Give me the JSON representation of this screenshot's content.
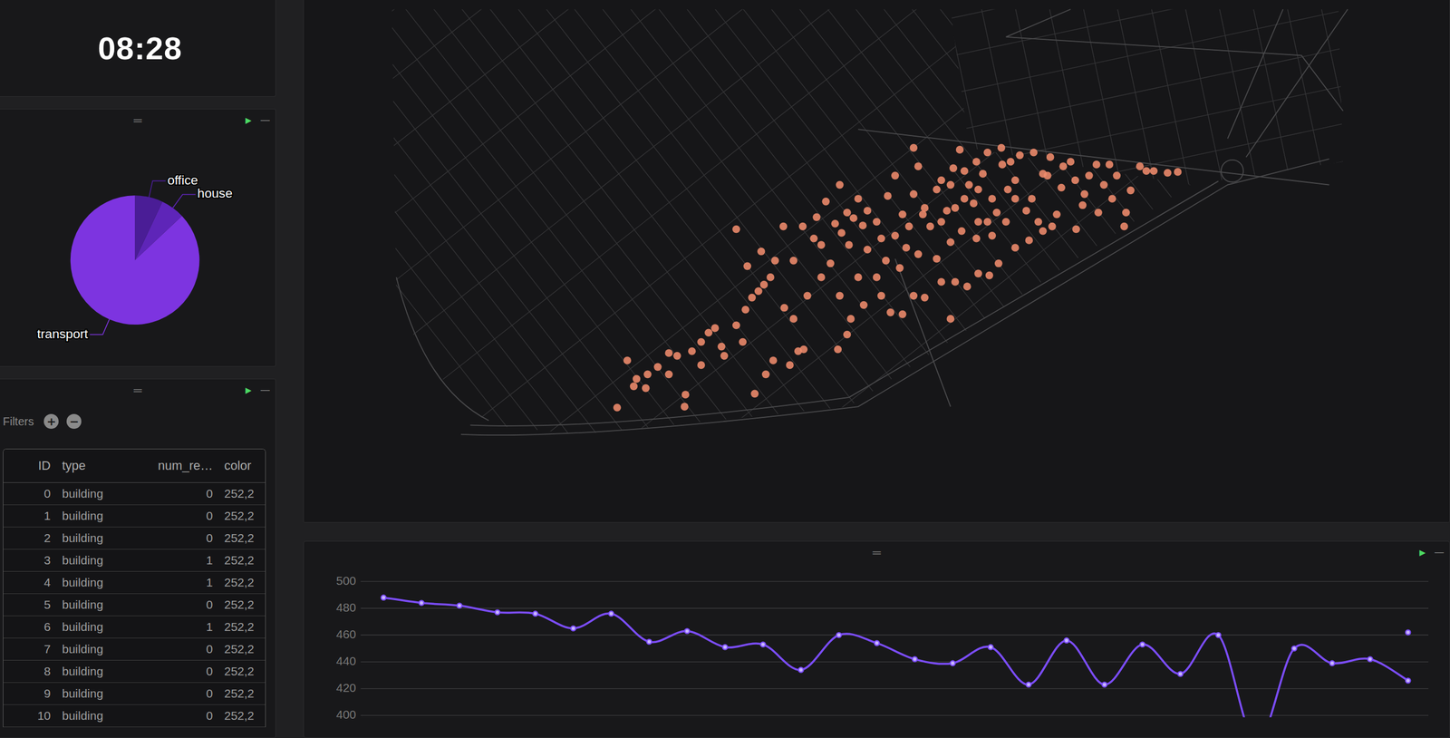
{
  "clock": {
    "time": "08:28"
  },
  "panel_controls": {
    "handle": "═",
    "play": "▶",
    "minimize": "—"
  },
  "pie": {
    "slices": [
      {
        "label": "office",
        "value": 7,
        "color": "#4a1d96"
      },
      {
        "label": "house",
        "value": 6,
        "color": "#5e25b8"
      },
      {
        "label": "transport",
        "value": 87,
        "color": "#7d34e0"
      }
    ]
  },
  "table": {
    "filters_label": "Filters",
    "add": "+",
    "remove": "−",
    "columns": [
      "ID",
      "type",
      "num_re…",
      "color"
    ],
    "rows": [
      {
        "id": "0",
        "type": "building",
        "num_residents": "0",
        "color": "252,2"
      },
      {
        "id": "1",
        "type": "building",
        "num_residents": "0",
        "color": "252,2"
      },
      {
        "id": "2",
        "type": "building",
        "num_residents": "0",
        "color": "252,2"
      },
      {
        "id": "3",
        "type": "building",
        "num_residents": "1",
        "color": "252,2"
      },
      {
        "id": "4",
        "type": "building",
        "num_residents": "1",
        "color": "252,2"
      },
      {
        "id": "5",
        "type": "building",
        "num_residents": "0",
        "color": "252,2"
      },
      {
        "id": "6",
        "type": "building",
        "num_residents": "1",
        "color": "252,2"
      },
      {
        "id": "7",
        "type": "building",
        "num_residents": "0",
        "color": "252,2"
      },
      {
        "id": "8",
        "type": "building",
        "num_residents": "0",
        "color": "252,2"
      },
      {
        "id": "9",
        "type": "building",
        "num_residents": "0",
        "color": "252,2"
      },
      {
        "id": "10",
        "type": "building",
        "num_residents": "0",
        "color": "252,2"
      }
    ]
  },
  "map": {
    "points": [
      [
        339,
        441
      ],
      [
        350,
        390
      ],
      [
        357,
        418
      ],
      [
        372,
        405
      ],
      [
        383,
        397
      ],
      [
        395,
        382
      ],
      [
        404,
        385
      ],
      [
        413,
        427
      ],
      [
        412,
        440
      ],
      [
        420,
        380
      ],
      [
        430,
        370
      ],
      [
        438,
        360
      ],
      [
        445,
        355
      ],
      [
        452,
        375
      ],
      [
        468,
        352
      ],
      [
        478,
        335
      ],
      [
        485,
        322
      ],
      [
        492,
        315
      ],
      [
        498,
        308
      ],
      [
        505,
        300
      ],
      [
        510,
        282
      ],
      [
        468,
        248
      ],
      [
        480,
        288
      ],
      [
        495,
        272
      ],
      [
        520,
        333
      ],
      [
        526,
        395
      ],
      [
        535,
        380
      ],
      [
        541,
        378
      ],
      [
        488,
        426
      ],
      [
        500,
        405
      ],
      [
        508,
        390
      ],
      [
        519,
        245
      ],
      [
        530,
        282
      ],
      [
        540,
        245
      ],
      [
        552,
        258
      ],
      [
        555,
        235
      ],
      [
        560,
        265
      ],
      [
        565,
        218
      ],
      [
        575,
        242
      ],
      [
        582,
        252
      ],
      [
        588,
        230
      ],
      [
        595,
        236
      ],
      [
        600,
        215
      ],
      [
        605,
        244
      ],
      [
        610,
        228
      ],
      [
        620,
        240
      ],
      [
        625,
        258
      ],
      [
        632,
        212
      ],
      [
        640,
        190
      ],
      [
        648,
        232
      ],
      [
        652,
        268
      ],
      [
        660,
        210
      ],
      [
        665,
        180
      ],
      [
        672,
        225
      ],
      [
        678,
        245
      ],
      [
        685,
        205
      ],
      [
        690,
        195
      ],
      [
        696,
        228
      ],
      [
        703,
        182
      ],
      [
        710,
        162
      ],
      [
        715,
        215
      ],
      [
        720,
        200
      ],
      [
        728,
        175
      ],
      [
        735,
        188
      ],
      [
        740,
        165
      ],
      [
        745,
        215
      ],
      [
        750,
        230
      ],
      [
        756,
        178
      ],
      [
        762,
        205
      ],
      [
        770,
        195
      ],
      [
        775,
        168
      ],
      [
        782,
        228
      ],
      [
        788,
        215
      ],
      [
        795,
        240
      ],
      [
        800,
        188
      ],
      [
        808,
        170
      ],
      [
        815,
        232
      ],
      [
        820,
        203
      ],
      [
        830,
        175
      ],
      [
        836,
        248
      ],
      [
        843,
        222
      ],
      [
        850,
        190
      ],
      [
        858,
        178
      ],
      [
        866,
        200
      ],
      [
        872,
        178
      ],
      [
        880,
        190
      ],
      [
        888,
        245
      ],
      [
        895,
        206
      ],
      [
        905,
        180
      ],
      [
        912,
        185
      ],
      [
        920,
        185
      ],
      [
        935,
        187
      ],
      [
        946,
        186
      ],
      [
        600,
        300
      ],
      [
        592,
        345
      ],
      [
        588,
        362
      ],
      [
        578,
        378
      ],
      [
        606,
        330
      ],
      [
        625,
        320
      ],
      [
        635,
        338
      ],
      [
        648,
        340
      ],
      [
        660,
        320
      ],
      [
        672,
        322
      ],
      [
        690,
        305
      ],
      [
        705,
        305
      ],
      [
        718,
        310
      ],
      [
        730,
        296
      ],
      [
        742,
        298
      ],
      [
        752,
        285
      ],
      [
        770,
        268
      ],
      [
        785,
        260
      ],
      [
        800,
        250
      ],
      [
        810,
        245
      ],
      [
        620,
        300
      ],
      [
        645,
        290
      ],
      [
        665,
        275
      ],
      [
        685,
        280
      ],
      [
        700,
        262
      ],
      [
        712,
        250
      ],
      [
        728,
        258
      ],
      [
        745,
        255
      ],
      [
        760,
        240
      ],
      [
        640,
        255
      ],
      [
        630,
        282
      ],
      [
        655,
        245
      ],
      [
        670,
        232
      ],
      [
        690,
        240
      ],
      [
        705,
        225
      ],
      [
        725,
        220
      ],
      [
        740,
        240
      ],
      [
        700,
        200
      ],
      [
        715,
        185
      ],
      [
        730,
        205
      ],
      [
        755,
        160
      ],
      [
        765,
        175
      ],
      [
        790,
        165
      ],
      [
        805,
        190
      ],
      [
        822,
        180
      ],
      [
        835,
        195
      ],
      [
        845,
        210
      ],
      [
        860,
        230
      ],
      [
        875,
        215
      ],
      [
        890,
        230
      ],
      [
        360,
        410
      ],
      [
        370,
        420
      ],
      [
        395,
        405
      ],
      [
        430,
        395
      ],
      [
        455,
        385
      ],
      [
        475,
        370
      ],
      [
        560,
        300
      ],
      [
        570,
        285
      ],
      [
        545,
        320
      ],
      [
        530,
        345
      ],
      [
        580,
        320
      ],
      [
        590,
        265
      ],
      [
        610,
        270
      ],
      [
        580,
        200
      ],
      [
        700,
        345
      ],
      [
        660,
        160
      ],
      [
        730,
        240
      ],
      [
        770,
        215
      ]
    ]
  },
  "chart": {
    "ticks": [
      "500",
      "480",
      "460",
      "440",
      "420",
      "400"
    ],
    "values": [
      488,
      484,
      482,
      477,
      476,
      465,
      476,
      455,
      463,
      451,
      453,
      434,
      460,
      454,
      442,
      439,
      451,
      423,
      456,
      423,
      453,
      431,
      460,
      380,
      450,
      439,
      442,
      426
    ],
    "highlight": 462
  }
}
